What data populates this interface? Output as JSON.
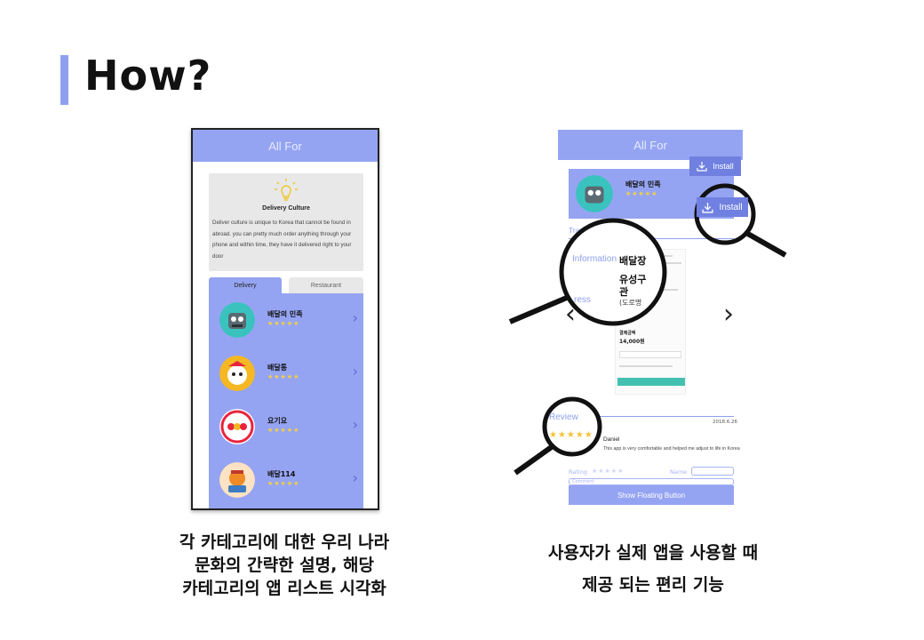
{
  "slide": {
    "title": "How?",
    "accent_color": "#8f9ff0"
  },
  "left_phone": {
    "header": "All For",
    "culture_card": {
      "icon": "lightbulb-icon",
      "title": "Delivery Culture",
      "description": "Deliver culture is unique to Korea that cannot be found in abroad. you can pretty much order anything through your phone and within time, they have it delivered right to your door"
    },
    "tabs": [
      {
        "label": "Delivery",
        "active": true
      },
      {
        "label": "Restaurant",
        "active": false
      }
    ],
    "apps": [
      {
        "name": "배달의 민족",
        "stars": "★★★★★",
        "icon": "baemin-app-icon",
        "color": "#3ac3be"
      },
      {
        "name": "배달통",
        "stars": "★★★★★",
        "icon": "baedaltong-app-icon",
        "color": "#f5b823"
      },
      {
        "name": "요기요",
        "stars": "★★★★★",
        "icon": "yogiyo-app-icon",
        "color": "#e8243c"
      },
      {
        "name": "배달114",
        "stars": "★★★★★",
        "icon": "baedal114-app-icon",
        "color": "#f08a24"
      }
    ]
  },
  "right_phone": {
    "header": "All For",
    "app_name": "배달의 민족",
    "app_stars": "★★★★★",
    "install_label": "Install",
    "translated_scene_label": "Translated Scene",
    "information_label": "Information",
    "address_label": "ress",
    "price_label": "결제금액",
    "price_value": "14,000원",
    "review_label": "Review",
    "review_date": "2018.6.26",
    "review_stars": "★★★★★",
    "review_user": "Daniel",
    "review_text": "This app is very comfortable and helped me adjust to life in Korea",
    "rating_label": "Rating",
    "rating_stars": "★★★★★",
    "name_label": "Name",
    "comment_placeholder": "Comment",
    "floating_button_label": "Show Floating Button"
  },
  "magnifier": {
    "word1": "배달장",
    "word2": "유성구",
    "word3": "관",
    "word4": "(도로명"
  },
  "captions": {
    "left": [
      "각 카테고리에 대한 우리 나라",
      "문화의 간략한 설명, 해당",
      "카테고리의 앱 리스트 시각화"
    ],
    "right": [
      "사용자가 실제 앱을 사용할 때",
      "제공 되는 편리 기능"
    ]
  }
}
